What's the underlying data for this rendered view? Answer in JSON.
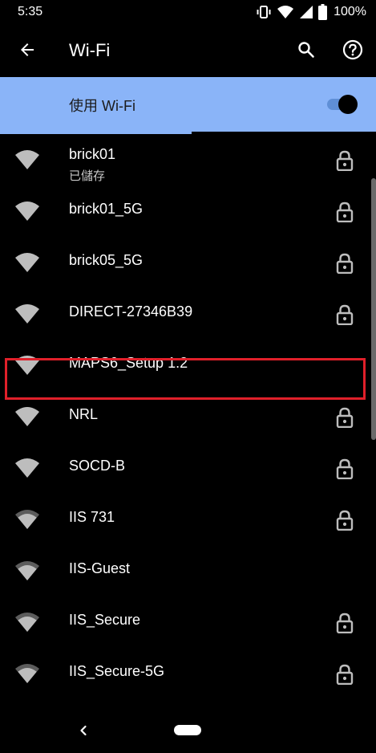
{
  "status_bar": {
    "time": "5:35",
    "battery_text": "100%",
    "icons": [
      "vibrate-icon",
      "wifi-status-icon",
      "signal-icon",
      "battery-icon"
    ]
  },
  "app_bar": {
    "title": "Wi-Fi",
    "icons": [
      "back-arrow-icon",
      "search-icon",
      "help-icon"
    ]
  },
  "master_switch": {
    "label": "使用 Wi-Fi",
    "state": "on",
    "accent_color": "#8ab4f8",
    "scan_progress": 0.51
  },
  "networks": [
    {
      "name": "brick01",
      "status": "已儲存",
      "secured": true,
      "signal": "full"
    },
    {
      "name": "brick01_5G",
      "secured": true,
      "signal": "full"
    },
    {
      "name": "brick05_5G",
      "secured": true,
      "signal": "full"
    },
    {
      "name": "DIRECT-27346B39",
      "secured": true,
      "signal": "full"
    },
    {
      "name": "MAPS6_Setup   1.2",
      "secured": false,
      "signal": "full",
      "highlighted": true
    },
    {
      "name": "NRL",
      "secured": true,
      "signal": "full"
    },
    {
      "name": "SOCD-B",
      "secured": true,
      "signal": "full"
    },
    {
      "name": "IIS 731",
      "secured": true,
      "signal": "strong"
    },
    {
      "name": "IIS-Guest",
      "secured": false,
      "signal": "strong"
    },
    {
      "name": "IIS_Secure",
      "secured": true,
      "signal": "strong"
    },
    {
      "name": "IIS_Secure-5G",
      "secured": true,
      "signal": "strong"
    }
  ],
  "highlight_color": "#e0202a",
  "nav_bar": {
    "icons": [
      "nav-back-icon",
      "nav-home-pill"
    ]
  }
}
